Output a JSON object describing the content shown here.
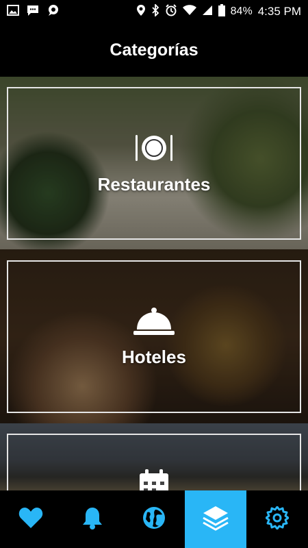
{
  "status_bar": {
    "battery": "84%",
    "time": "4:35 PM"
  },
  "header": {
    "title": "Categorías"
  },
  "categories": [
    {
      "label": "Restaurantes",
      "icon": "plate-cutlery-icon"
    },
    {
      "label": "Hoteles",
      "icon": "service-bell-icon"
    },
    {
      "label": "",
      "icon": "calendar-icon"
    }
  ],
  "bottom_nav": {
    "items": [
      {
        "icon": "heart-icon",
        "active": false
      },
      {
        "icon": "bell-icon",
        "active": false
      },
      {
        "icon": "globe-icon",
        "active": false
      },
      {
        "icon": "layers-icon",
        "active": true
      },
      {
        "icon": "gear-icon",
        "active": false
      }
    ],
    "accent_color": "#29b6f6",
    "icon_color": "#29b6f6"
  }
}
